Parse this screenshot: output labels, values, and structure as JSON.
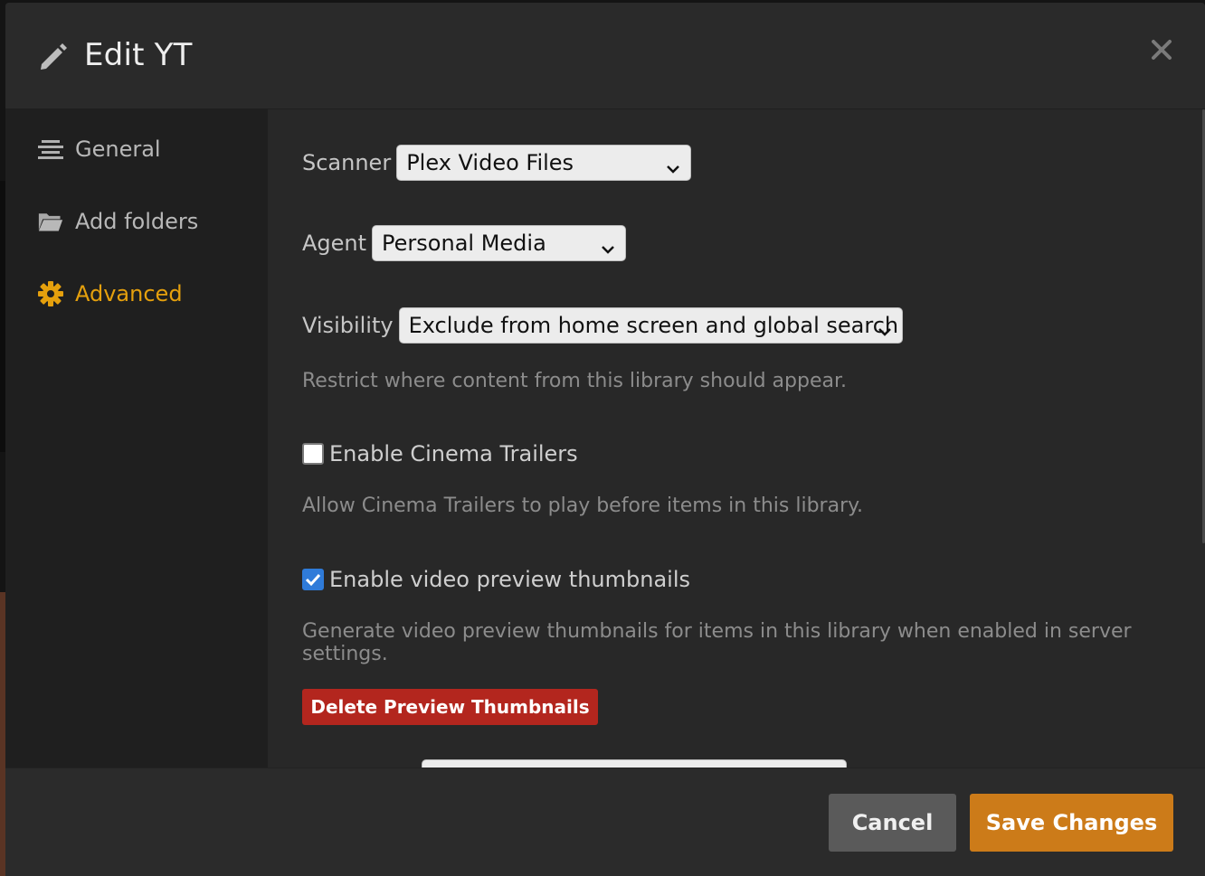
{
  "dialog": {
    "title": "Edit YT",
    "close_icon": "close-icon",
    "edit_icon": "pencil-icon"
  },
  "sidebar": {
    "items": [
      {
        "label": "General",
        "icon": "list-icon",
        "active": false
      },
      {
        "label": "Add folders",
        "icon": "folder-icon",
        "active": false
      },
      {
        "label": "Advanced",
        "icon": "gear-icon",
        "active": true
      }
    ]
  },
  "form": {
    "scanner": {
      "label": "Scanner",
      "value": "Plex Video Files"
    },
    "agent": {
      "label": "Agent",
      "value": "Personal Media"
    },
    "visibility": {
      "label": "Visibility",
      "value": "Exclude from home screen and global search",
      "hint": "Restrict where content from this library should appear."
    },
    "cinema_trailers": {
      "label": "Enable Cinema Trailers",
      "checked": false,
      "hint": "Allow Cinema Trailers to play before items in this library."
    },
    "video_thumbnails": {
      "label": "Enable video preview thumbnails",
      "checked": true,
      "hint": "Generate video preview thumbnails for items in this library when enabled in server settings."
    },
    "delete_thumbnails_label": "Delete Preview Thumbnails"
  },
  "footer": {
    "cancel_label": "Cancel",
    "save_label": "Save Changes"
  },
  "colors": {
    "accent": "#e5a00d",
    "save": "#cc7b19",
    "danger": "#b3261e",
    "checkbox": "#2f7bd9"
  }
}
